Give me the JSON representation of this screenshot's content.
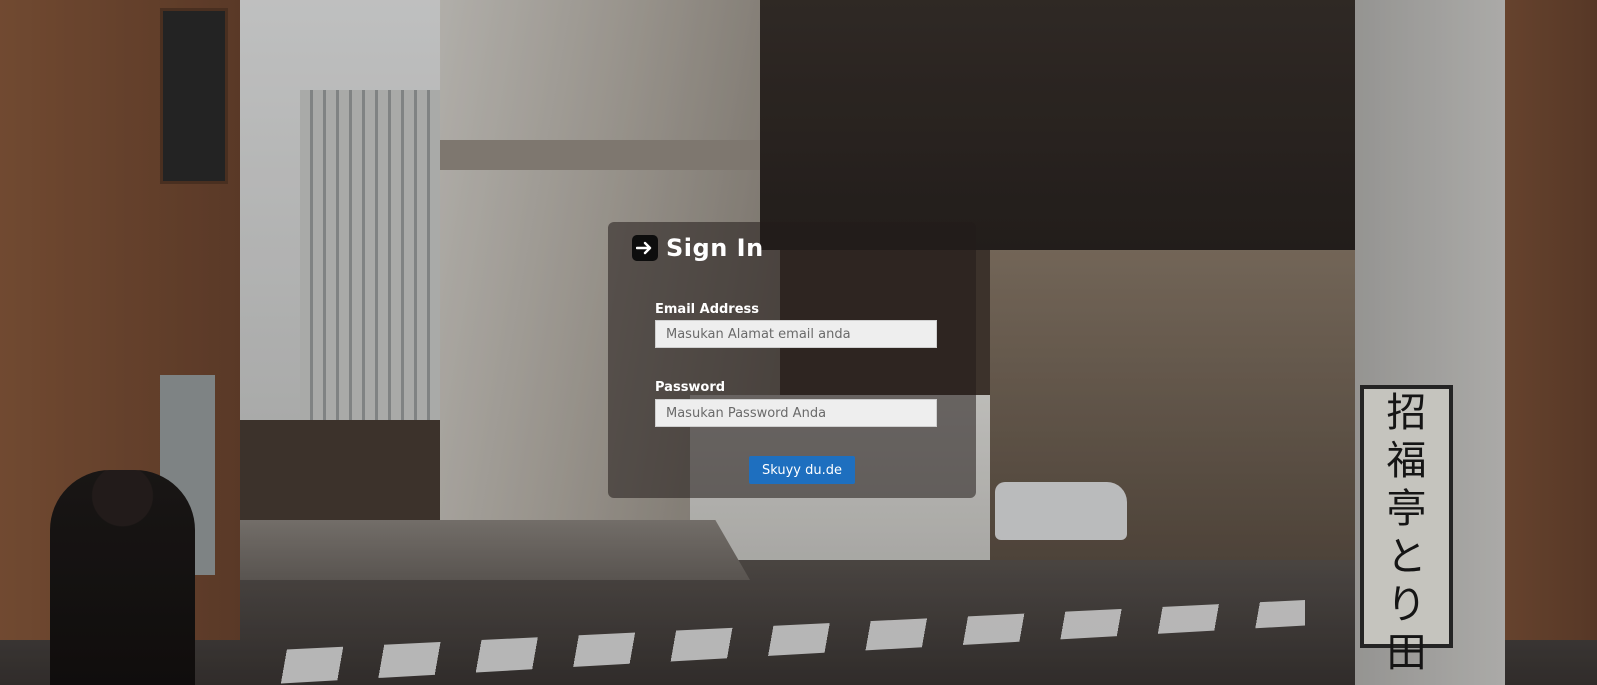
{
  "login": {
    "title": "Sign In",
    "title_icon": "sign-in-arrow-icon",
    "email_label": "Email Address",
    "email_placeholder": "Masukan Alamat email anda",
    "password_label": "Password",
    "password_placeholder": "Masukan Password Anda",
    "submit_label": "Skuyy du.de"
  },
  "background": {
    "sign_text": [
      "招",
      "福",
      "亭",
      "と",
      "り",
      "田"
    ]
  },
  "colors": {
    "button": "#1e6fbf",
    "card": "rgba(34,28,26,0.55)",
    "input": "#eeeeee"
  }
}
